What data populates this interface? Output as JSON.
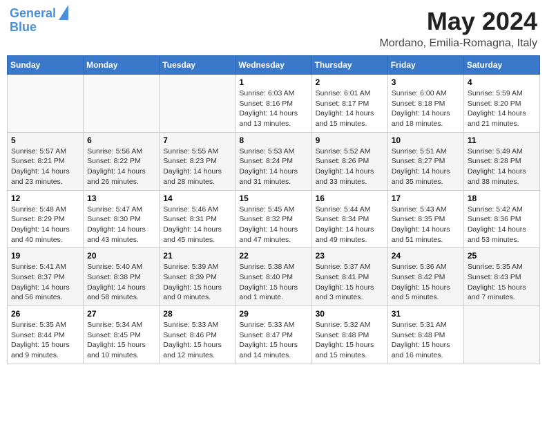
{
  "header": {
    "logo_line1": "General",
    "logo_line2": "Blue",
    "title": "May 2024",
    "subtitle": "Mordano, Emilia-Romagna, Italy"
  },
  "weekdays": [
    "Sunday",
    "Monday",
    "Tuesday",
    "Wednesday",
    "Thursday",
    "Friday",
    "Saturday"
  ],
  "weeks": [
    [
      {
        "day": "",
        "info": ""
      },
      {
        "day": "",
        "info": ""
      },
      {
        "day": "",
        "info": ""
      },
      {
        "day": "1",
        "info": "Sunrise: 6:03 AM\nSunset: 8:16 PM\nDaylight: 14 hours\nand 13 minutes."
      },
      {
        "day": "2",
        "info": "Sunrise: 6:01 AM\nSunset: 8:17 PM\nDaylight: 14 hours\nand 15 minutes."
      },
      {
        "day": "3",
        "info": "Sunrise: 6:00 AM\nSunset: 8:18 PM\nDaylight: 14 hours\nand 18 minutes."
      },
      {
        "day": "4",
        "info": "Sunrise: 5:59 AM\nSunset: 8:20 PM\nDaylight: 14 hours\nand 21 minutes."
      }
    ],
    [
      {
        "day": "5",
        "info": "Sunrise: 5:57 AM\nSunset: 8:21 PM\nDaylight: 14 hours\nand 23 minutes."
      },
      {
        "day": "6",
        "info": "Sunrise: 5:56 AM\nSunset: 8:22 PM\nDaylight: 14 hours\nand 26 minutes."
      },
      {
        "day": "7",
        "info": "Sunrise: 5:55 AM\nSunset: 8:23 PM\nDaylight: 14 hours\nand 28 minutes."
      },
      {
        "day": "8",
        "info": "Sunrise: 5:53 AM\nSunset: 8:24 PM\nDaylight: 14 hours\nand 31 minutes."
      },
      {
        "day": "9",
        "info": "Sunrise: 5:52 AM\nSunset: 8:26 PM\nDaylight: 14 hours\nand 33 minutes."
      },
      {
        "day": "10",
        "info": "Sunrise: 5:51 AM\nSunset: 8:27 PM\nDaylight: 14 hours\nand 35 minutes."
      },
      {
        "day": "11",
        "info": "Sunrise: 5:49 AM\nSunset: 8:28 PM\nDaylight: 14 hours\nand 38 minutes."
      }
    ],
    [
      {
        "day": "12",
        "info": "Sunrise: 5:48 AM\nSunset: 8:29 PM\nDaylight: 14 hours\nand 40 minutes."
      },
      {
        "day": "13",
        "info": "Sunrise: 5:47 AM\nSunset: 8:30 PM\nDaylight: 14 hours\nand 43 minutes."
      },
      {
        "day": "14",
        "info": "Sunrise: 5:46 AM\nSunset: 8:31 PM\nDaylight: 14 hours\nand 45 minutes."
      },
      {
        "day": "15",
        "info": "Sunrise: 5:45 AM\nSunset: 8:32 PM\nDaylight: 14 hours\nand 47 minutes."
      },
      {
        "day": "16",
        "info": "Sunrise: 5:44 AM\nSunset: 8:34 PM\nDaylight: 14 hours\nand 49 minutes."
      },
      {
        "day": "17",
        "info": "Sunrise: 5:43 AM\nSunset: 8:35 PM\nDaylight: 14 hours\nand 51 minutes."
      },
      {
        "day": "18",
        "info": "Sunrise: 5:42 AM\nSunset: 8:36 PM\nDaylight: 14 hours\nand 53 minutes."
      }
    ],
    [
      {
        "day": "19",
        "info": "Sunrise: 5:41 AM\nSunset: 8:37 PM\nDaylight: 14 hours\nand 56 minutes."
      },
      {
        "day": "20",
        "info": "Sunrise: 5:40 AM\nSunset: 8:38 PM\nDaylight: 14 hours\nand 58 minutes."
      },
      {
        "day": "21",
        "info": "Sunrise: 5:39 AM\nSunset: 8:39 PM\nDaylight: 15 hours\nand 0 minutes."
      },
      {
        "day": "22",
        "info": "Sunrise: 5:38 AM\nSunset: 8:40 PM\nDaylight: 15 hours\nand 1 minute."
      },
      {
        "day": "23",
        "info": "Sunrise: 5:37 AM\nSunset: 8:41 PM\nDaylight: 15 hours\nand 3 minutes."
      },
      {
        "day": "24",
        "info": "Sunrise: 5:36 AM\nSunset: 8:42 PM\nDaylight: 15 hours\nand 5 minutes."
      },
      {
        "day": "25",
        "info": "Sunrise: 5:35 AM\nSunset: 8:43 PM\nDaylight: 15 hours\nand 7 minutes."
      }
    ],
    [
      {
        "day": "26",
        "info": "Sunrise: 5:35 AM\nSunset: 8:44 PM\nDaylight: 15 hours\nand 9 minutes."
      },
      {
        "day": "27",
        "info": "Sunrise: 5:34 AM\nSunset: 8:45 PM\nDaylight: 15 hours\nand 10 minutes."
      },
      {
        "day": "28",
        "info": "Sunrise: 5:33 AM\nSunset: 8:46 PM\nDaylight: 15 hours\nand 12 minutes."
      },
      {
        "day": "29",
        "info": "Sunrise: 5:33 AM\nSunset: 8:47 PM\nDaylight: 15 hours\nand 14 minutes."
      },
      {
        "day": "30",
        "info": "Sunrise: 5:32 AM\nSunset: 8:48 PM\nDaylight: 15 hours\nand 15 minutes."
      },
      {
        "day": "31",
        "info": "Sunrise: 5:31 AM\nSunset: 8:48 PM\nDaylight: 15 hours\nand 16 minutes."
      },
      {
        "day": "",
        "info": ""
      }
    ]
  ]
}
